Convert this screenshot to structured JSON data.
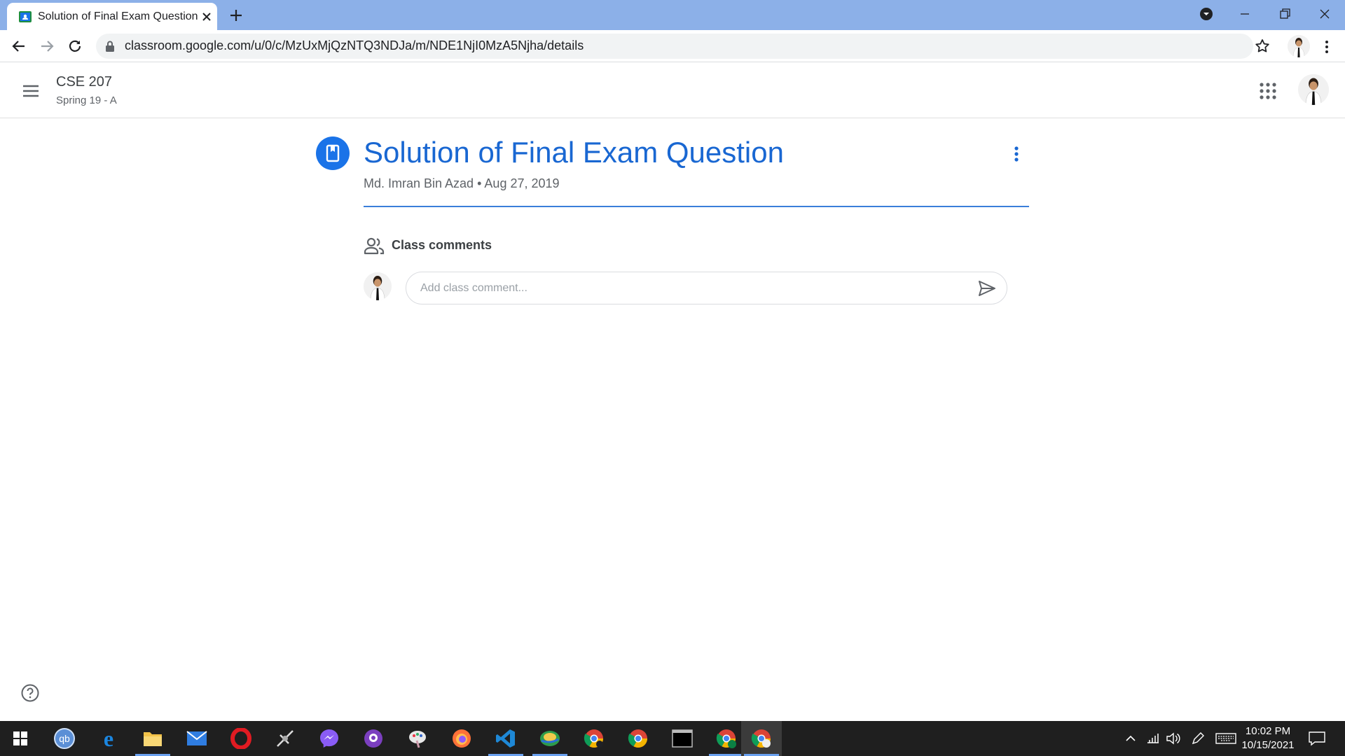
{
  "browser": {
    "tab_title": "Solution of Final Exam Question",
    "url": "classroom.google.com/u/0/c/MzUxMjQzNTQ3NDJa/m/NDE1NjI0MzA5Njha/details"
  },
  "header": {
    "course_name": "CSE 207",
    "course_section": "Spring 19 - A"
  },
  "post": {
    "title": "Solution of Final Exam Question",
    "author": "Md. Imran Bin Azad",
    "separator": "•",
    "date": "Aug 27, 2019"
  },
  "comments": {
    "label": "Class comments",
    "placeholder": "Add class comment...",
    "value": ""
  },
  "taskbar": {
    "time": "10:02 PM",
    "date": "10/15/2021",
    "apps": [
      "start-icon",
      "qbittorrent-icon",
      "edge-icon",
      "file-explorer-icon",
      "mail-icon",
      "opera-icon",
      "satellite-app-icon",
      "messenger-icon",
      "github-desktop-icon",
      "paint-app-icon",
      "firefox-icon",
      "vscode-icon",
      "earth-app-icon",
      "chrome-profile-icon",
      "chrome-icon",
      "terminal-icon",
      "chrome-ek-icon",
      "chrome-active-icon"
    ]
  },
  "colors": {
    "accent": "#1967d2",
    "tabstrip": "#8cb0e8",
    "taskbar": "#1f1f1f"
  }
}
